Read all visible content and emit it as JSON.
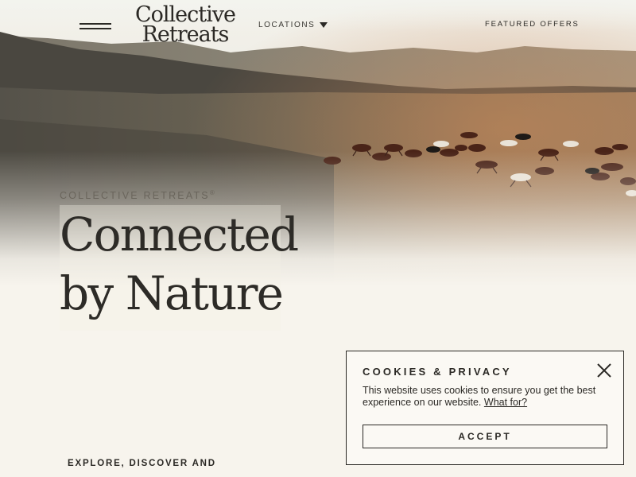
{
  "header": {
    "logo_line1": "Collective",
    "logo_line2": "Retreats",
    "locations_label": "LOCATIONS",
    "featured_offers_label": "FEATURED OFFERS"
  },
  "hero": {
    "kicker": "COLLECTIVE RETREATS",
    "kicker_mark": "®",
    "headline_line1": "Connected",
    "headline_line2": "by Nature"
  },
  "intro": {
    "explore_text": "EXPLORE, DISCOVER AND"
  },
  "cookie_banner": {
    "title": "COOKIES & PRIVACY",
    "body": "This website uses cookies to ensure you get the best experience on our website.",
    "link_label": "What for?",
    "accept_label": "ACCEPT"
  },
  "icons": {
    "menu": "hamburger-menu-icon",
    "locations_dropdown": "caret-down-icon",
    "close": "close-icon"
  },
  "colors": {
    "page_background": "#f7f4ed",
    "text": "#2b2925",
    "panel_background": "#fbf9f4"
  }
}
